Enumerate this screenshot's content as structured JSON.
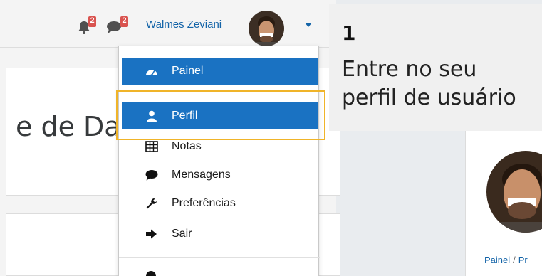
{
  "header": {
    "notifications_count": "2",
    "messages_count": "2",
    "username": "Walmes Zeviani"
  },
  "user_menu": {
    "items": [
      {
        "label": "Painel",
        "icon": "dashboard-icon"
      },
      {
        "label": "Perfil",
        "icon": "user-icon"
      },
      {
        "label": "Notas",
        "icon": "grades-table-icon"
      },
      {
        "label": "Mensagens",
        "icon": "chat-bubble-icon"
      },
      {
        "label": "Preferências",
        "icon": "wrench-icon"
      },
      {
        "label": "Sair",
        "icon": "sign-out-icon"
      }
    ]
  },
  "course": {
    "title_fragment": "e de Dac"
  },
  "callout": {
    "step": "1",
    "line1": "Entre no seu",
    "line2": "perfil de usuário"
  },
  "breadcrumb": {
    "home": "Painel",
    "separator": "/",
    "current_fragment": "Pr"
  },
  "colors": {
    "accent": "#1a72c2",
    "link": "#1464a8",
    "badge": "#d9534f",
    "highlight": "#f0b429"
  }
}
